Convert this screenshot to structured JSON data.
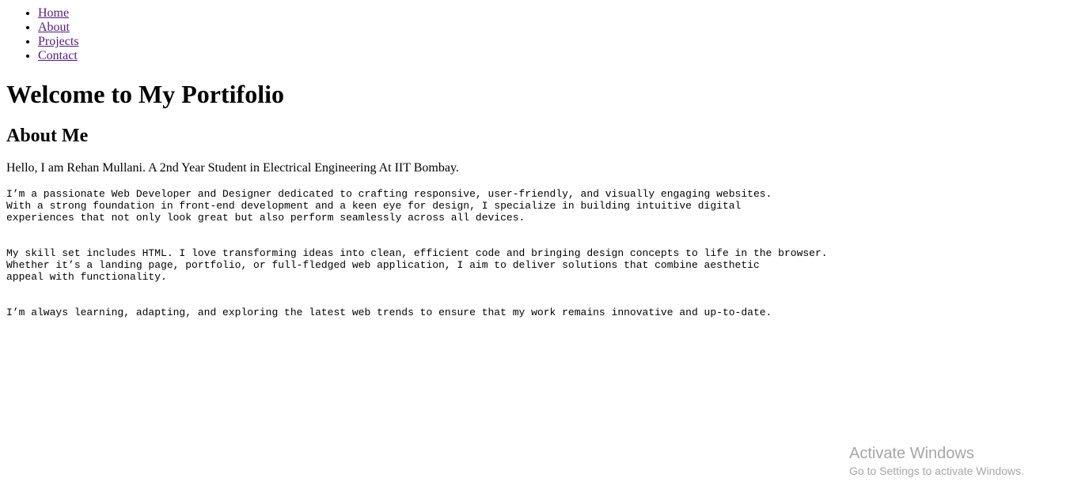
{
  "nav": {
    "items": [
      {
        "label": "Home"
      },
      {
        "label": "About"
      },
      {
        "label": "Projects"
      },
      {
        "label": "Contact"
      }
    ]
  },
  "page": {
    "title": "Welcome to My Portifolio",
    "section_heading": "About Me",
    "intro": "Hello, I am Rehan Mullani. A 2nd Year Student in Electrical Engineering At IIT Bombay.",
    "paragraphs": [
      {
        "lines": [
          "I’m a passionate Web Developer and Designer dedicated to crafting responsive, user-friendly, and visually engaging websites.",
          "With a strong foundation in front-end development and a keen eye for design, I specialize in building intuitive digital",
          "experiences that not only look great but also perform seamlessly across all devices."
        ]
      },
      {
        "lines": [
          "My skill set includes HTML. I love transforming ideas into clean, efficient code and bringing design concepts to life in the browser.",
          "Whether it’s a landing page, portfolio, or full-fledged web application, I aim to deliver solutions that combine aesthetic",
          "appeal with functionality."
        ]
      },
      {
        "lines": [
          "I’m always learning, adapting, and exploring the latest web trends to ensure that my work remains innovative and up-to-date."
        ]
      }
    ]
  },
  "watermark": {
    "title": "Activate Windows",
    "subtitle": "Go to Settings to activate Windows."
  },
  "colors": {
    "visited_link": "#551a8b",
    "watermark": "#a6a6a6"
  }
}
